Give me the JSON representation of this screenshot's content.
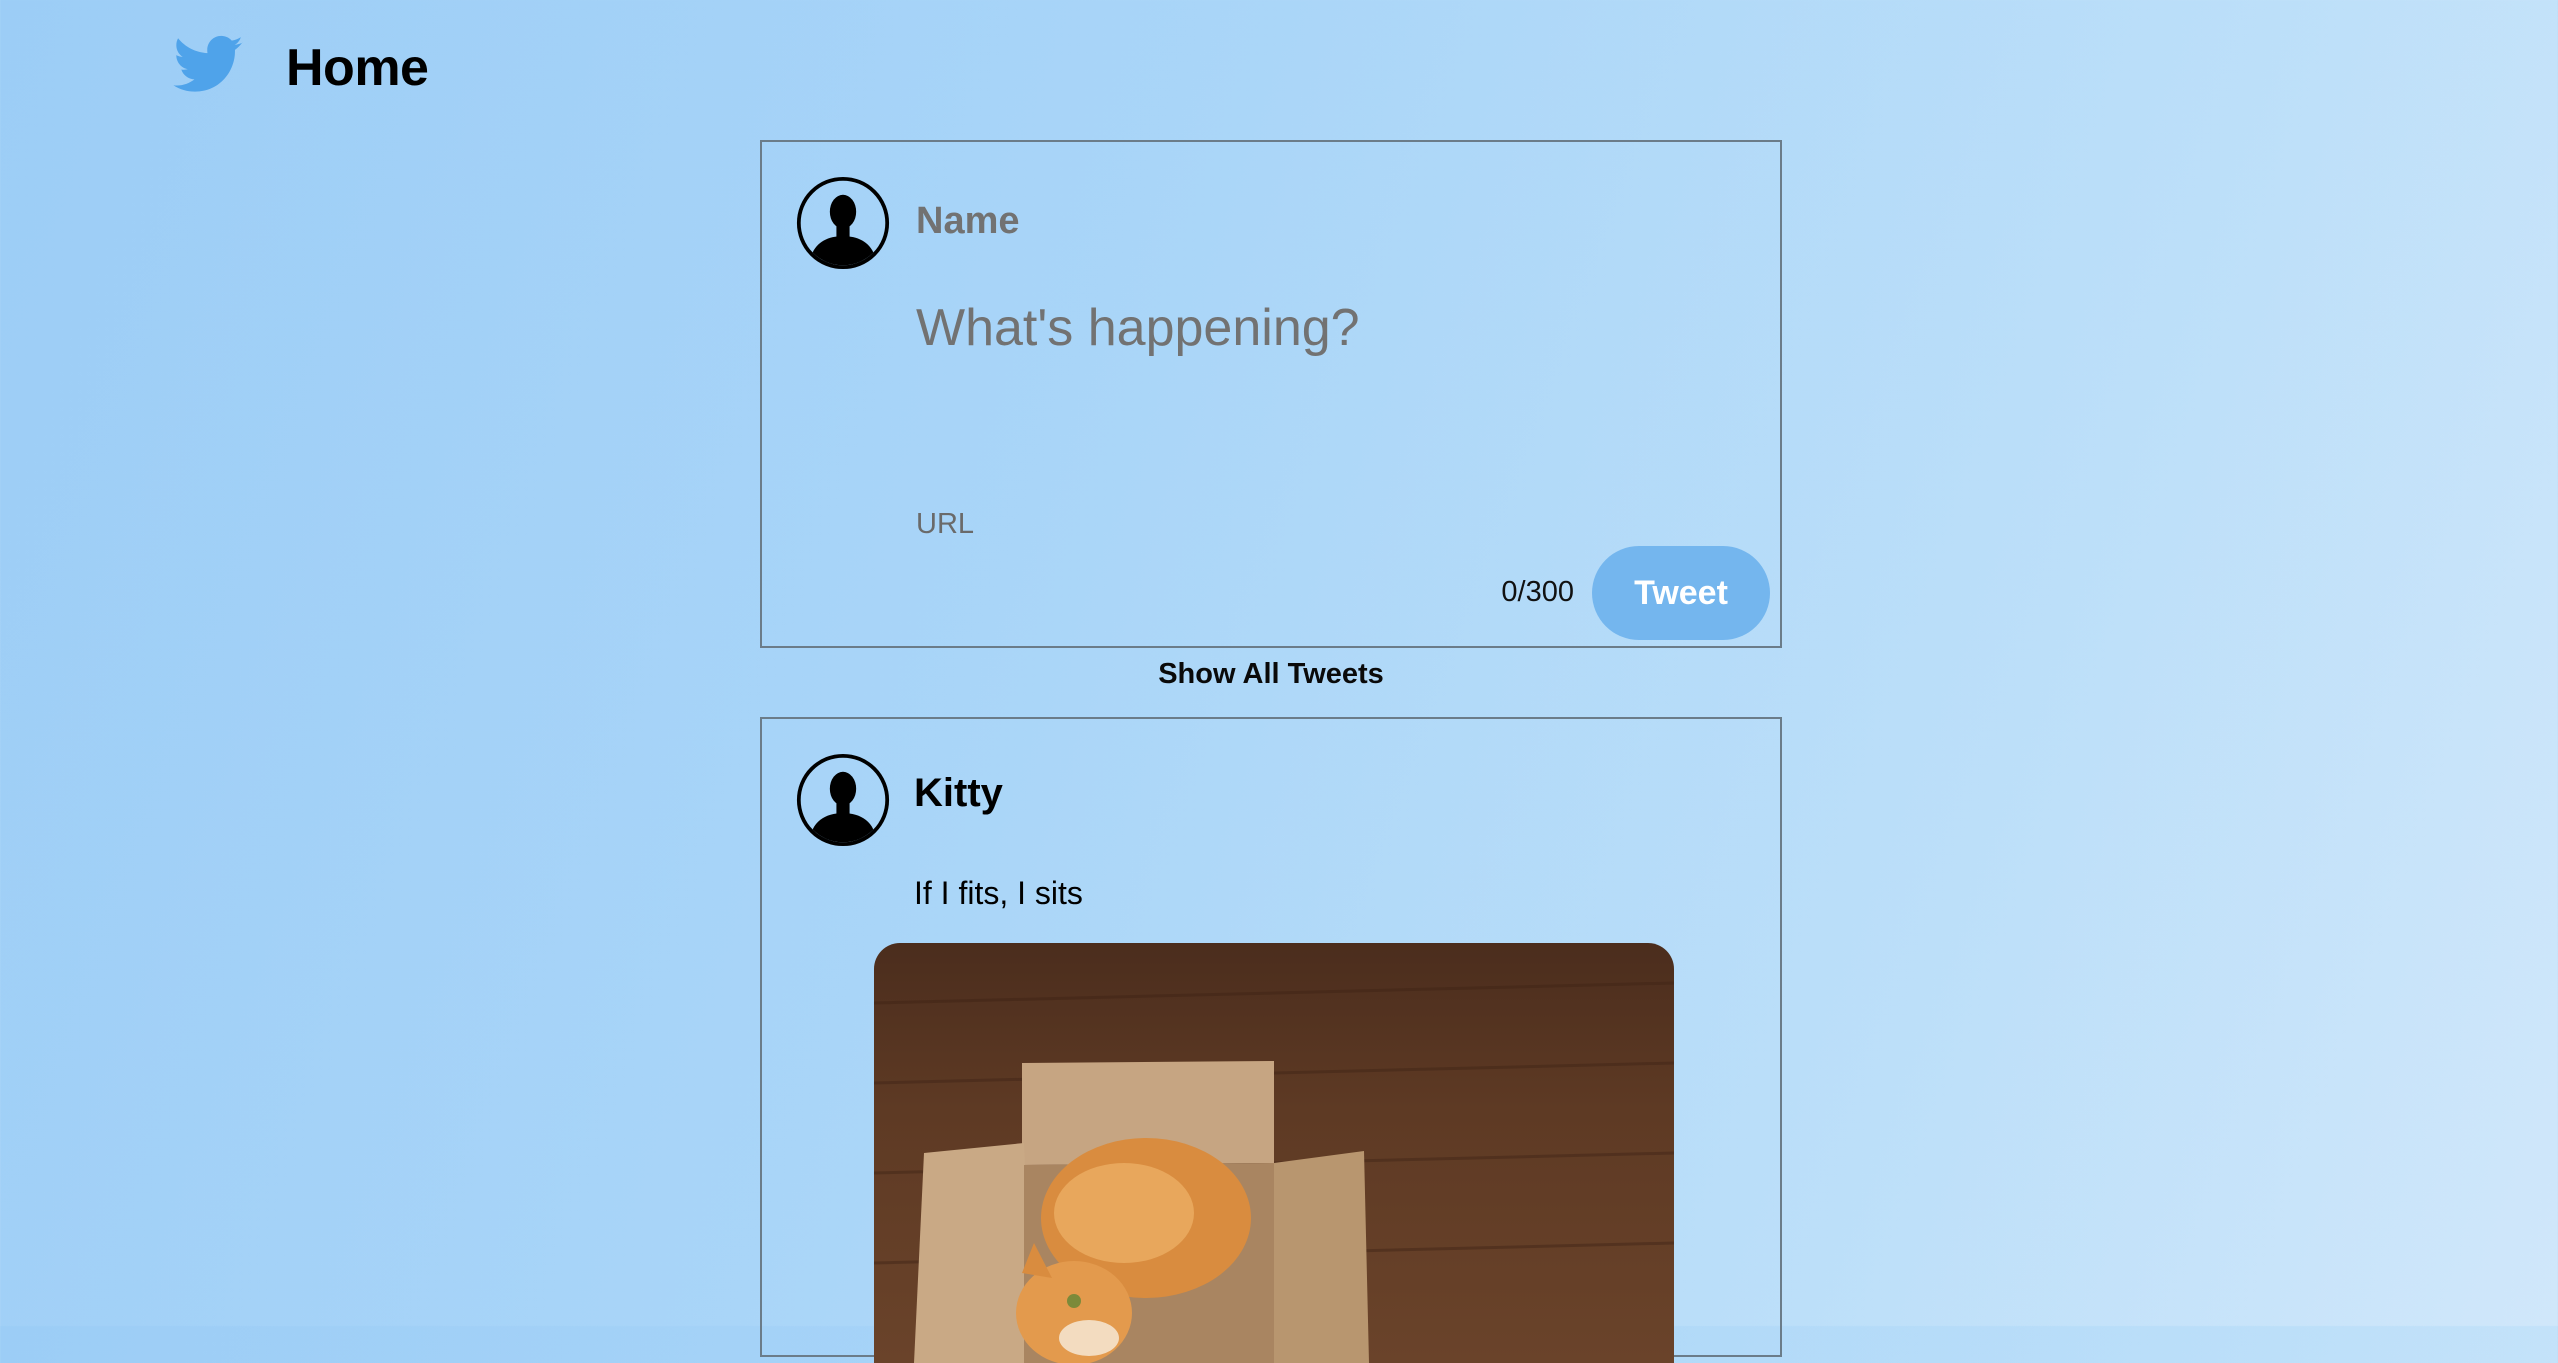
{
  "header": {
    "title": "Home",
    "logo_icon": "twitter-bird-icon"
  },
  "compose": {
    "name_placeholder": "Name",
    "text_placeholder": "What's happening?",
    "url_placeholder": "URL",
    "counter": "0/300",
    "tweet_button_label": "Tweet"
  },
  "show_all_label": "Show All Tweets",
  "tweets": [
    {
      "author": "Kitty",
      "text": "If I fits, I sits",
      "image_icon": "cat-in-box-photo"
    }
  ],
  "colors": {
    "accent": "#74b6ee",
    "logo": "#4fa3ea"
  }
}
